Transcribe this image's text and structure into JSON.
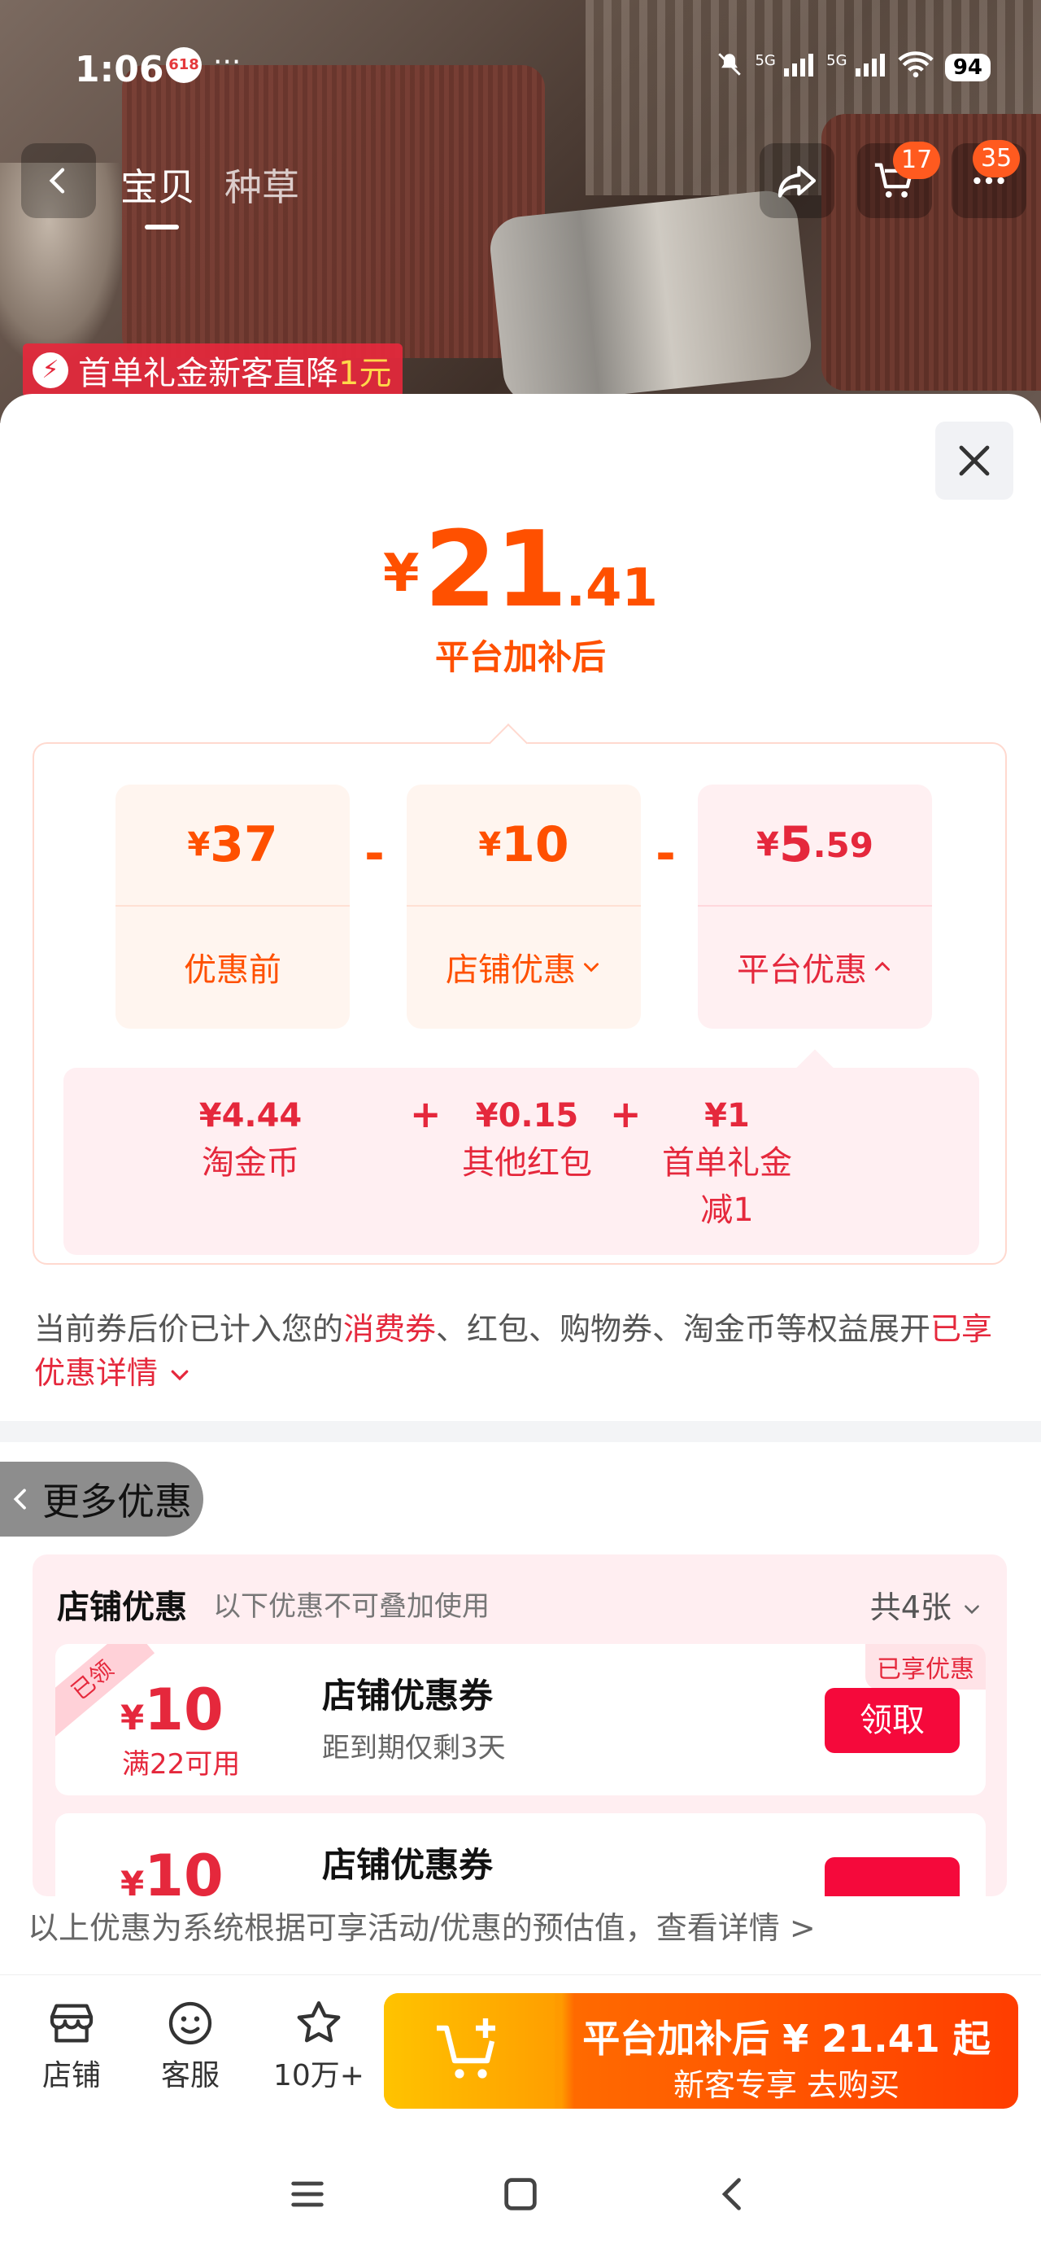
{
  "status_bar": {
    "time": "1:06",
    "app_badge": "618",
    "more": "···",
    "signal_1": "5G",
    "signal_2": "5G",
    "battery": "94"
  },
  "nav": {
    "tabs": [
      "宝贝",
      "种草"
    ],
    "active_tab": 0,
    "cart_badge": "17",
    "more_badge": "35"
  },
  "promo_strip": {
    "text": "首单礼金新客直降",
    "highlight": "1元"
  },
  "price": {
    "currency": "¥",
    "integer": "21",
    "decimal": ".41",
    "caption": "平台加补后"
  },
  "breakdown": {
    "items": [
      {
        "currency": "¥",
        "integer": "37",
        "decimal": "",
        "label": "优惠前",
        "chevron": ""
      },
      {
        "currency": "¥",
        "integer": "10",
        "decimal": "",
        "label": "店铺优惠",
        "chevron": "⌄"
      },
      {
        "currency": "¥",
        "integer": "5",
        "decimal": ".59",
        "label": "平台优惠",
        "chevron": "⌃"
      }
    ],
    "operators": [
      "-",
      "-"
    ],
    "platform_details": [
      {
        "value": "¥4.44",
        "label": "淘金币",
        "label2": ""
      },
      {
        "value": "¥0.15",
        "label": "其他红包",
        "label2": ""
      },
      {
        "value": "¥1",
        "label": "首单礼金",
        "label2": "减1"
      }
    ],
    "plus": "+"
  },
  "note": {
    "part1": "当前券后价已计入您的",
    "red1": "消费券",
    "part2": "、红包、购物券、淘金币等权益展开",
    "red2": "已享优惠详情",
    "chevron": "⌄"
  },
  "more_offers": {
    "label": "更多优惠"
  },
  "shop_offers": {
    "title": "店铺优惠",
    "subtitle": "以下优惠不可叠加使用",
    "count": "共4张",
    "coupons": [
      {
        "ribbon": "已领",
        "currency": "¥",
        "amount": "10",
        "condition": "满22可用",
        "title": "店铺优惠券",
        "expiry": "距到期仅剩3天",
        "tag": "已享优惠",
        "button": "领取"
      },
      {
        "ribbon": "",
        "currency": "¥",
        "amount": "10",
        "condition": "",
        "title": "店铺优惠券",
        "expiry": "",
        "tag": "",
        "button": ""
      }
    ]
  },
  "footnote": "以上优惠为系统根据可享活动/优惠的预估值，查看详情 >",
  "bottom_bar": {
    "shop": "店铺",
    "service": "客服",
    "favorites": "10万+",
    "buy_line1": "平台加补后 ¥ 21.41 起",
    "buy_line2": "新客专享 去购买"
  },
  "colors": {
    "accent_orange": "#ff5000",
    "accent_red": "#e5283c",
    "button_red": "#f5093b"
  }
}
